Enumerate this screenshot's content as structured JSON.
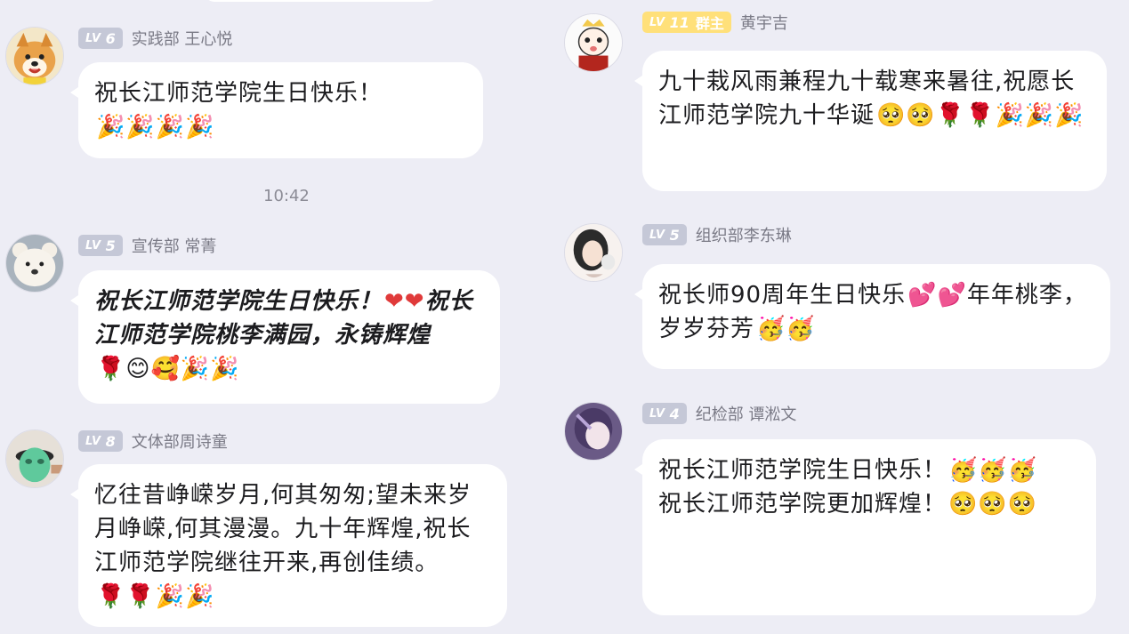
{
  "timestamp": "10:42",
  "messages": [
    {
      "id": "left1",
      "level_tag": "LV",
      "level_num": "6",
      "sender": "实践部 王心悦",
      "text": "祝长江师范学院生日快乐！",
      "emoji": "🎉🎉🎉🎉",
      "avatar": "shiba-dog-avatar"
    },
    {
      "id": "left2",
      "level_tag": "LV",
      "level_num": "5",
      "sender": "宣传部 常菁",
      "text": "祝长江师范学院生日快乐！",
      "emoji1": "❤❤",
      "text2": "祝长江师范学院桃李满园，永铸辉煌",
      "emoji2": "🌹😊🥰🎉🎉",
      "avatar": "white-bear-avatar"
    },
    {
      "id": "left3",
      "level_tag": "LV",
      "level_num": "8",
      "sender": "文体部周诗童",
      "text": "忆往昔峥嵘岁月,何其匆匆;望未来岁月峥嵘,何其漫漫。九十年辉煌,祝长江师范学院继往开来,再创佳绩。",
      "emoji": "🌹🌹🎉🎉",
      "avatar": "green-mask-avatar"
    },
    {
      "id": "right1",
      "level_tag": "LV",
      "level_num": "11",
      "role": "群主",
      "sender": "黄宇吉",
      "text": "九十栽风雨兼程九十载寒来暑往,祝愿长江师范学院九十华诞",
      "emoji": "🥺🥺🌹🌹🎉🎉🎉",
      "avatar": "cartoon-prince-avatar"
    },
    {
      "id": "right2",
      "level_tag": "LV",
      "level_num": "5",
      "sender": "组织部李东琳",
      "text": "祝长师90周年生日快乐",
      "emoji1": "💕💕",
      "text2": "年年桃李，岁岁芬芳",
      "emoji2": "🥳🥳",
      "avatar": "anime-girl-avatar"
    },
    {
      "id": "right3",
      "level_tag": "LV",
      "level_num": "4",
      "sender": "纪检部 谭淞文",
      "text": "祝长江师范学院生日快乐！",
      "emoji1": "🥳🥳🥳",
      "text2": "祝长江师范学院更加辉煌！",
      "emoji2": "🥺🥺🥺",
      "avatar": "anime-character-avatar"
    }
  ]
}
